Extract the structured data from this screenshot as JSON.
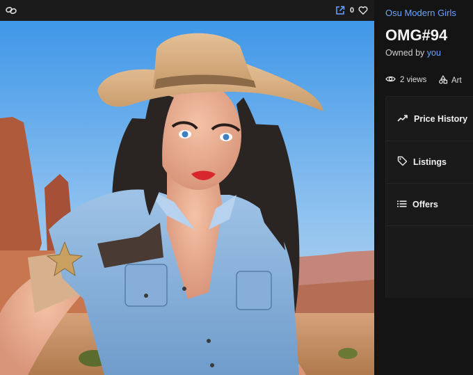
{
  "toolbar": {
    "link_icon": "link-icon",
    "external_icon": "external-link-icon",
    "like_count": "0",
    "heart_icon": "heart-icon"
  },
  "artwork": {
    "subject": "cowgirl portrait in desert canyon"
  },
  "panel": {
    "collection": "Osu Modern Girls",
    "title": "OMG#94",
    "owned_prefix": "Owned by",
    "owner": "you",
    "views": "2 views",
    "category": "Art",
    "sections": [
      {
        "label": "Price History",
        "icon": "trend-line-icon"
      },
      {
        "label": "Listings",
        "icon": "tag-icon"
      },
      {
        "label": "Offers",
        "icon": "list-icon"
      }
    ]
  },
  "colors": {
    "accent": "#6aa6ff",
    "background": "#141414",
    "topbar": "#1b1b1b"
  }
}
